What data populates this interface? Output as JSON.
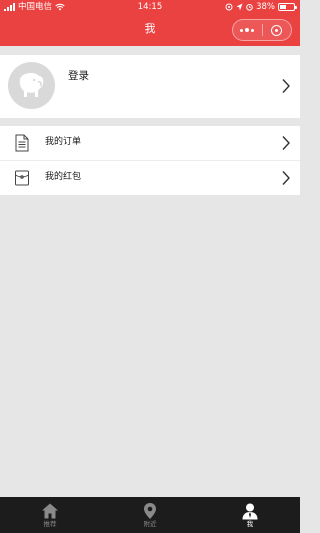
{
  "status_bar": {
    "carrier": "中国电信",
    "time": "14:15",
    "battery_percent": "38%",
    "battery_level": 0.38
  },
  "nav": {
    "title": "我"
  },
  "profile": {
    "login_label": "登录"
  },
  "menu": {
    "items": [
      {
        "label": "我的订单",
        "icon": "document-icon"
      },
      {
        "label": "我的红包",
        "icon": "red-packet-icon"
      }
    ]
  },
  "tabbar": {
    "items": [
      {
        "label": "推荐",
        "icon": "home-icon",
        "active": false
      },
      {
        "label": "附近",
        "icon": "location-pin-icon",
        "active": false
      },
      {
        "label": "我",
        "icon": "person-icon",
        "active": true
      }
    ]
  },
  "colors": {
    "header": "#ea4141",
    "background": "#e6e6e6",
    "tabbar": "#1c1c1c"
  }
}
